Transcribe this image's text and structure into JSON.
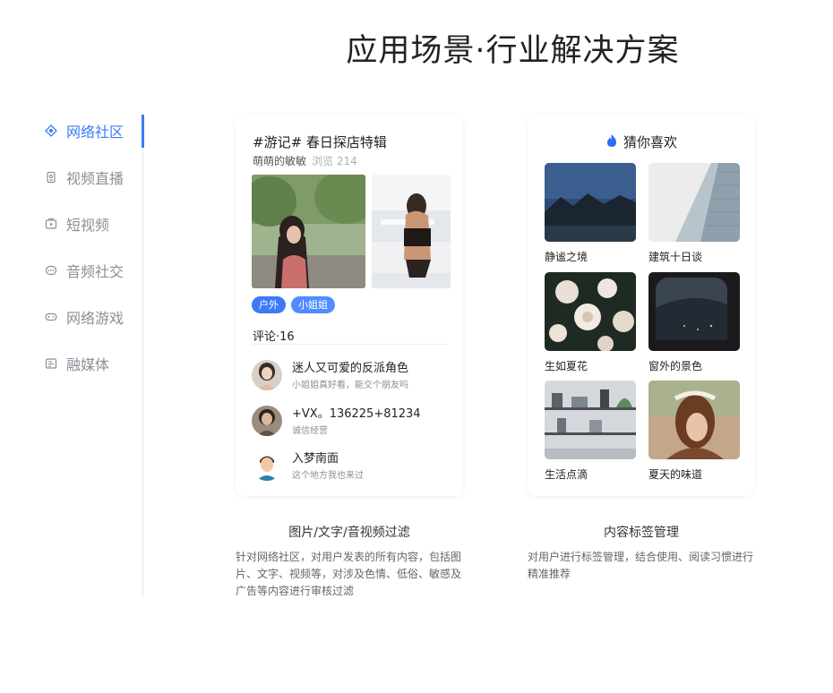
{
  "page": {
    "title": "应用场景·行业解决方案"
  },
  "sidebar": {
    "items": [
      {
        "label": "网络社区",
        "icon": "community-icon",
        "active": true
      },
      {
        "label": "视频直播",
        "icon": "live-icon",
        "active": false
      },
      {
        "label": "短视频",
        "icon": "short-video-icon",
        "active": false
      },
      {
        "label": "音频社交",
        "icon": "audio-icon",
        "active": false
      },
      {
        "label": "网络游戏",
        "icon": "game-icon",
        "active": false
      },
      {
        "label": "融媒体",
        "icon": "media-icon",
        "active": false
      }
    ]
  },
  "post_card": {
    "title": "#游记# 春日探店特辑",
    "author": "萌萌的敏敏",
    "views": "浏览 214",
    "tags": [
      "户外",
      "小姐姐"
    ],
    "comments_header": "评论·16",
    "comments": [
      {
        "name": "迷人又可爱的反派角色",
        "text": "小姐姐真好看，能交个朋友吗"
      },
      {
        "name": "+VX。136225+81234",
        "text": "诚信经营"
      },
      {
        "name": "入梦南面",
        "text": "这个地方我也来过"
      }
    ]
  },
  "rec_card": {
    "title": "猜你喜欢",
    "items": [
      {
        "label": "静谧之境"
      },
      {
        "label": "建筑十日谈"
      },
      {
        "label": "生如夏花"
      },
      {
        "label": "窗外的景色"
      },
      {
        "label": "生活点滴"
      },
      {
        "label": "夏天的味道"
      }
    ]
  },
  "features": [
    {
      "title": "图片/文字/音视频过滤",
      "desc": "针对网络社区，对用户发表的所有内容，包括图片、文字、视频等，对涉及色情、低俗、敏感及广告等内容进行审核过滤"
    },
    {
      "title": "内容标签管理",
      "desc": "对用户进行标签管理，结合使用、阅读习惯进行精准推荐"
    }
  ],
  "colors": {
    "accent": "#3b7bf6",
    "muted": "#8a8f98"
  }
}
